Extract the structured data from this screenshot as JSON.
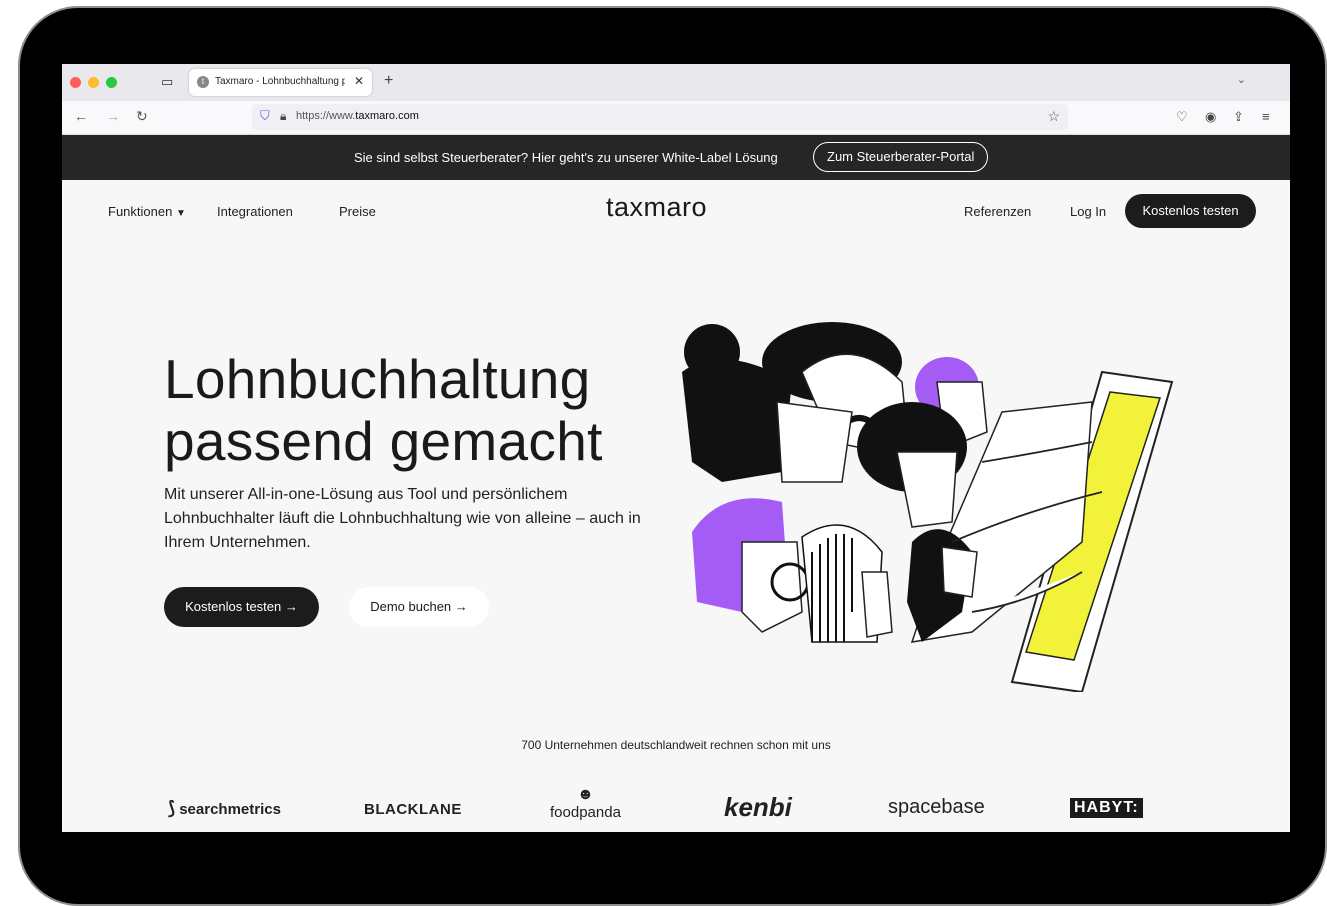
{
  "browser": {
    "tab_title": "Taxmaro - Lohnbuchhaltung passend gemacht",
    "tab_favicon": "t",
    "url_prefix": "https://www.",
    "url_domain": "taxmaro.com"
  },
  "banner": {
    "message": "Sie sind selbst Steuerberater? Hier geht's zu unserer White-Label Lösung",
    "portal_button": "Zum Steuerberater-Portal"
  },
  "nav": {
    "funktionen": "Funktionen",
    "integrationen": "Integrationen",
    "preise": "Preise",
    "logo": "taxmaro",
    "referenzen": "Referenzen",
    "login": "Log In",
    "cta": "Kostenlos testen"
  },
  "hero": {
    "title_line1": "Lohnbuchhaltung",
    "title_line2": "passend gemacht",
    "lead": "Mit unserer All-in-one-Lösung aus Tool und persönlichem Lohnbuchhalter läuft die Lohnbuchhaltung wie von alleine – auch in Ihrem Unternehmen.",
    "primary_button": "Kostenlos testen →",
    "secondary_button": "Demo buchen →"
  },
  "trust": {
    "headline": "700 Unternehmen deutschlandweit rechnen schon mit uns",
    "logos": [
      "searchmetrics",
      "BLACKLANE",
      "foodpanda",
      "kenbi",
      "spacebase",
      "HABYT:"
    ]
  },
  "colors": {
    "banner_bg": "#262626",
    "page_bg": "#f7f7f7",
    "accent_purple": "#a55cf5",
    "accent_yellow": "#f2f23a",
    "button_dark": "#1c1c1c"
  }
}
